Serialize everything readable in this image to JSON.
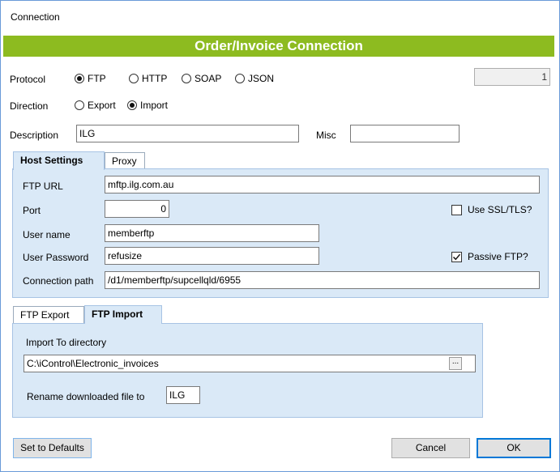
{
  "window": {
    "title": "Connection"
  },
  "banner": {
    "title": "Order/Invoice Connection"
  },
  "protocol": {
    "label": "Protocol",
    "options": [
      "FTP",
      "HTTP",
      "SOAP",
      "JSON"
    ],
    "selected": "FTP"
  },
  "counter": {
    "value": "1"
  },
  "direction": {
    "label": "Direction",
    "options": [
      "Export",
      "Import"
    ],
    "selected": "Import"
  },
  "description": {
    "label": "Description",
    "value": "ILG"
  },
  "misc": {
    "label": "Misc",
    "value": ""
  },
  "host_tabs": {
    "tabs": [
      "Host Settings",
      "Proxy"
    ],
    "active": "Host Settings"
  },
  "host": {
    "ftp_url_label": "FTP URL",
    "ftp_url": "mftp.ilg.com.au",
    "port_label": "Port",
    "port": "0",
    "use_ssl_label": "Use SSL/TLS?",
    "use_ssl": false,
    "user_name_label": "User name",
    "user_name": "memberftp",
    "user_password_label": "User Password",
    "user_password": "refusize",
    "passive_label": "Passive FTP?",
    "passive": true,
    "connection_path_label": "Connection path",
    "connection_path": "/d1/memberftp/supcellqld/6955"
  },
  "ftp_tabs": {
    "tabs": [
      "FTP Export",
      "FTP Import"
    ],
    "active": "FTP Import"
  },
  "ftp_import": {
    "import_dir_label": "Import To directory",
    "import_dir": "C:\\iControl\\Electronic_invoices",
    "browse_label": "...",
    "rename_label": "Rename downloaded file to",
    "rename_value": "ILG"
  },
  "buttons": {
    "defaults": "Set to Defaults",
    "cancel": "Cancel",
    "ok": "OK"
  },
  "colors": {
    "banner": "#8dbb20",
    "panel": "#dae9f7",
    "accent": "#0078d7"
  }
}
